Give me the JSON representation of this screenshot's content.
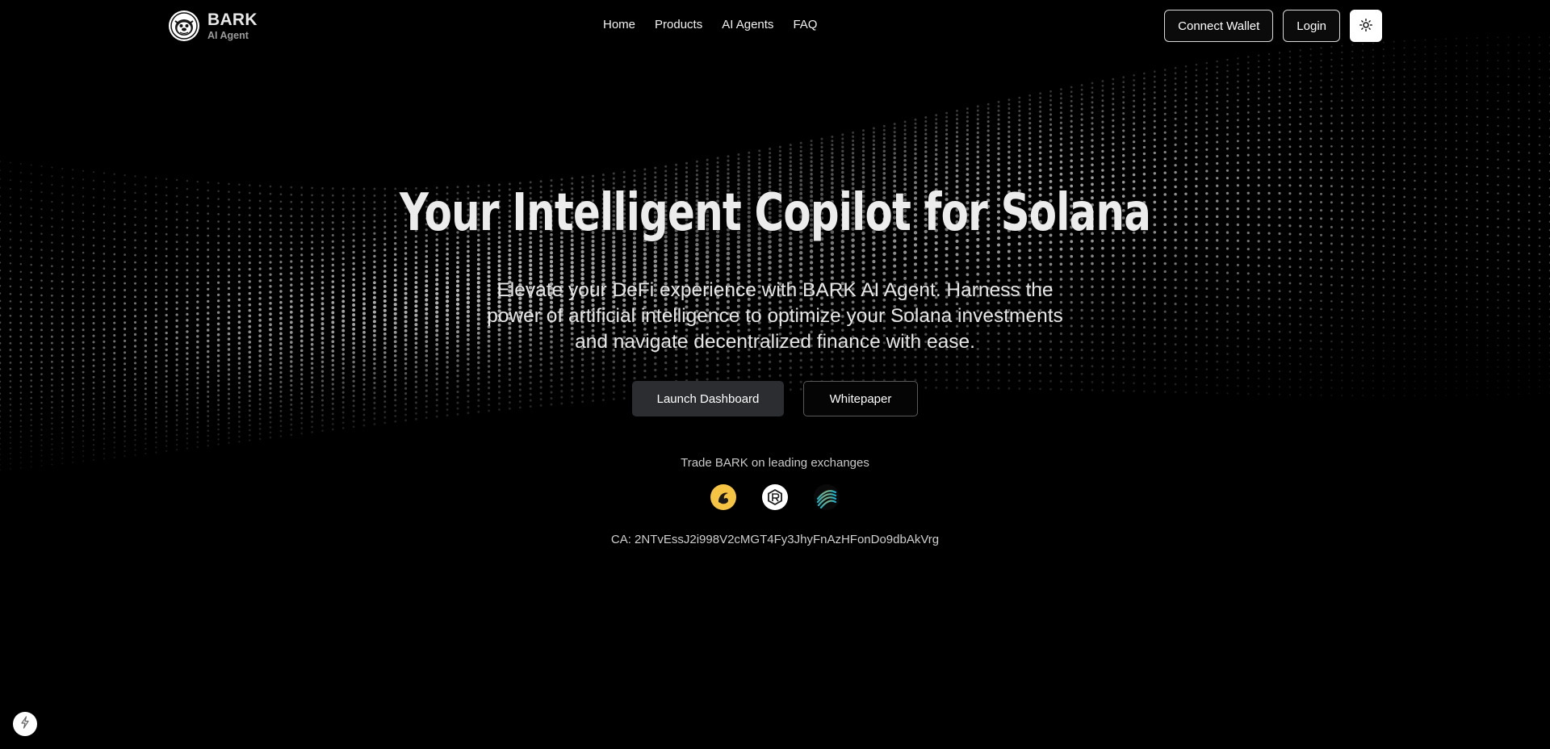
{
  "brand": {
    "name": "BARK",
    "subtitle": "AI Agent",
    "logo_icon": "bulldog-logo-icon"
  },
  "nav": {
    "items": [
      {
        "label": "Home"
      },
      {
        "label": "Products"
      },
      {
        "label": "AI Agents"
      },
      {
        "label": "FAQ"
      }
    ]
  },
  "header_actions": {
    "connect_wallet_label": "Connect Wallet",
    "login_label": "Login",
    "theme_toggle_icon": "sun-icon"
  },
  "hero": {
    "title": "Your Intelligent Copilot for Solana",
    "description": "Elevate your DeFi experience with BARK AI Agent. Harness the power of artificial intelligence to optimize your Solana investments and navigate decentralized finance with ease.",
    "primary_cta_label": "Launch Dashboard",
    "secondary_cta_label": "Whitepaper"
  },
  "exchanges": {
    "label": "Trade BARK on leading exchanges",
    "items": [
      {
        "icon": "birdeye-exchange-icon",
        "color": "#f5c443"
      },
      {
        "icon": "raydium-exchange-icon",
        "color": "#ffffff"
      },
      {
        "icon": "meteora-exchange-icon",
        "color": "#1ab4c4"
      }
    ]
  },
  "contract": {
    "text": "CA: 2NTvEssJ2i998V2cMGT4Fy3JhyFnAzHFonDo9dbAkVrg"
  },
  "corner_badge": {
    "icon": "lightning-icon"
  },
  "colors": {
    "background": "#000000",
    "primary_button": "#2b2d31",
    "text": "#ffffff"
  }
}
